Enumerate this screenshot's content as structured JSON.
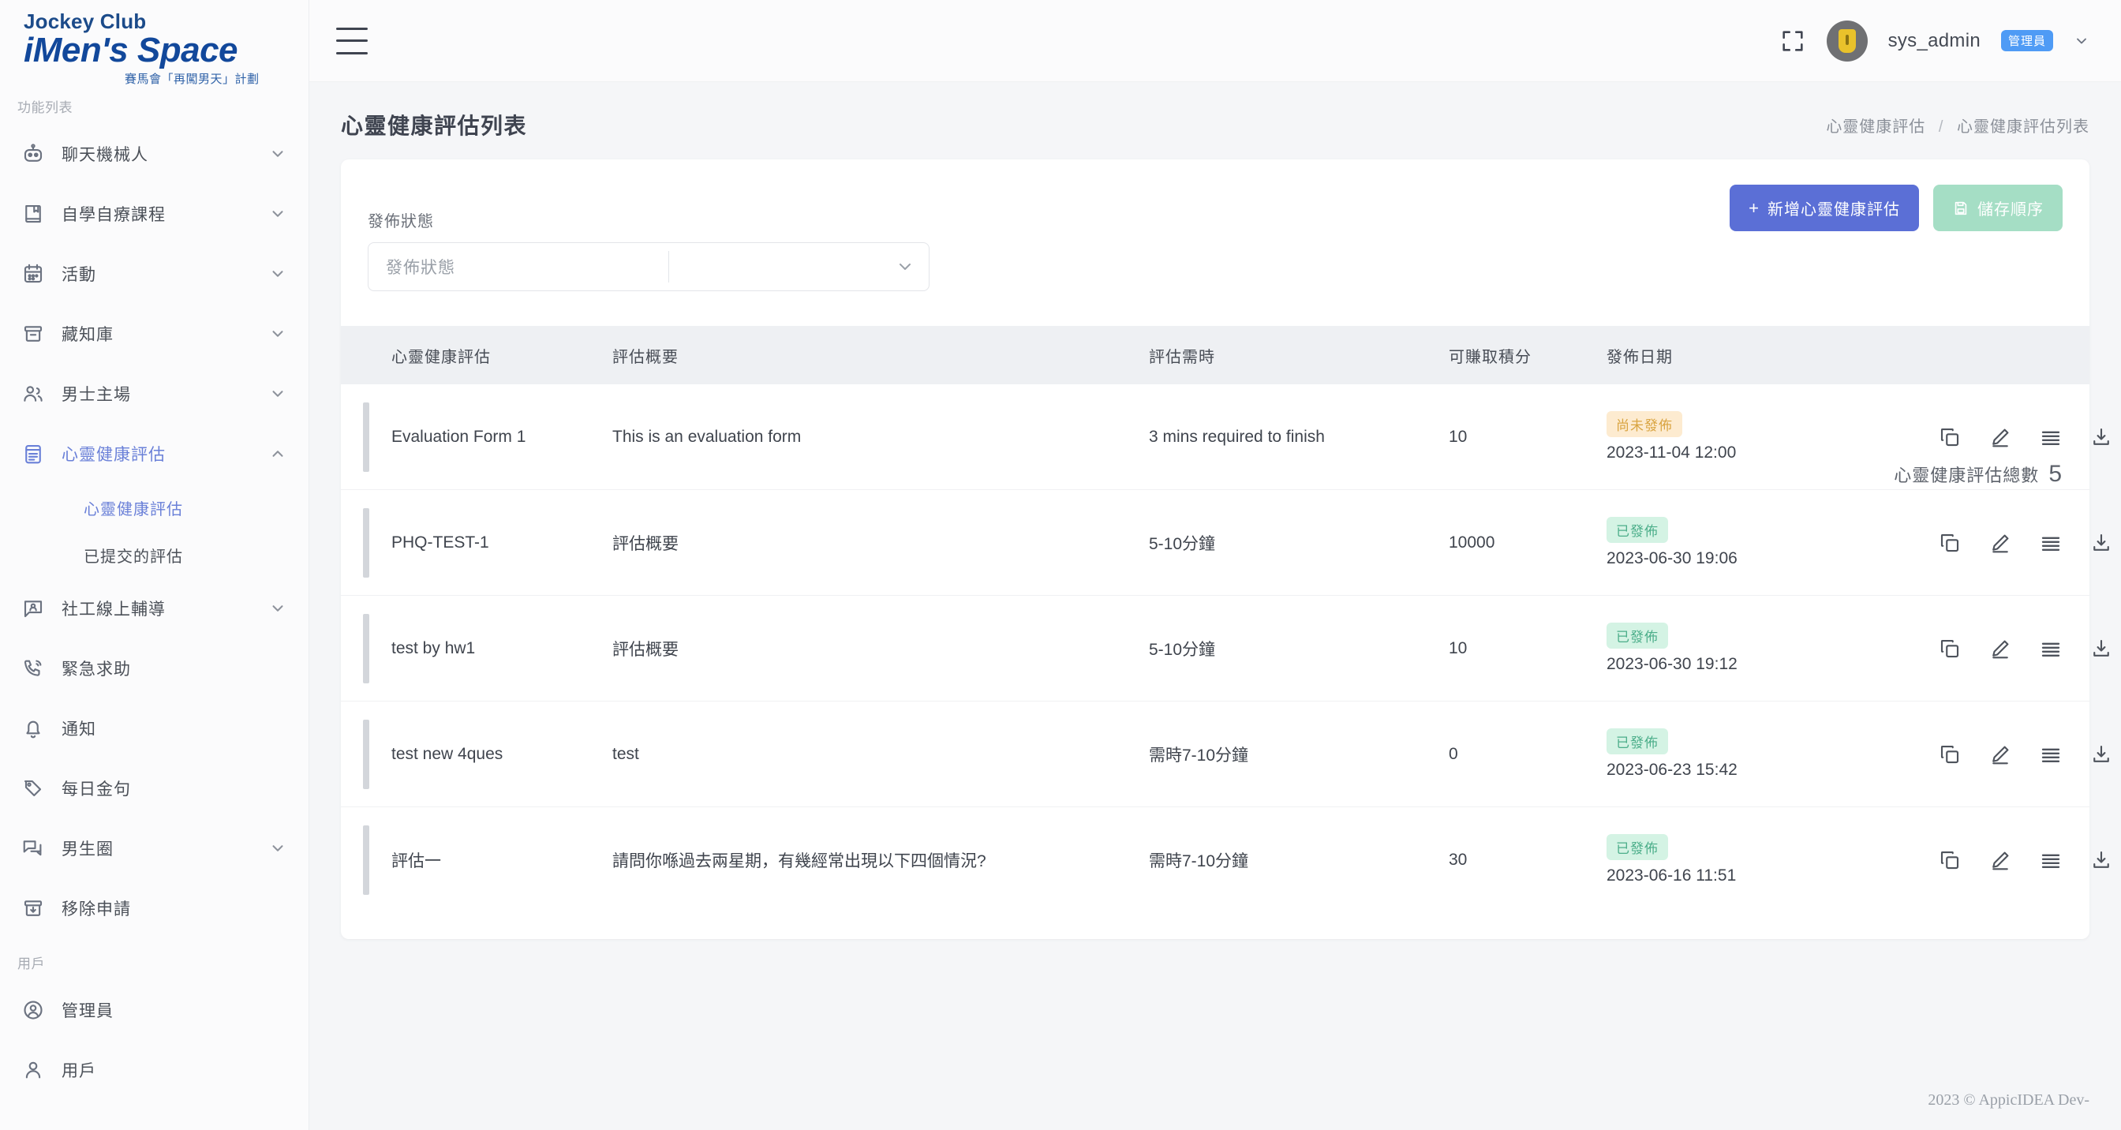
{
  "brand": {
    "line1": "Jockey Club",
    "line2": "iMen's Space",
    "line3": "賽馬會「再闖男天」計劃"
  },
  "topbar": {
    "menu_icon": "hamburger-icon",
    "fullscreen_icon": "fullscreen-icon",
    "username": "sys_admin",
    "role_badge": "管理員",
    "caret_icon": "chevron-down-icon"
  },
  "sidebar": {
    "section_label": "功能列表",
    "items": [
      {
        "label": "聊天機械人",
        "icon": "robot-icon",
        "expandable": true,
        "active": false
      },
      {
        "label": "自學自療課程",
        "icon": "book-icon",
        "expandable": true,
        "active": false
      },
      {
        "label": "活動",
        "icon": "calendar-icon",
        "expandable": true,
        "active": false
      },
      {
        "label": "藏知庫",
        "icon": "archive-icon",
        "expandable": true,
        "active": false
      },
      {
        "label": "男士主場",
        "icon": "users-icon",
        "expandable": true,
        "active": false
      },
      {
        "label": "心靈健康評估",
        "icon": "clipboard-icon",
        "expandable": true,
        "active": true
      },
      {
        "label": "社工線上輔導",
        "icon": "chat-user-icon",
        "expandable": true,
        "active": false
      },
      {
        "label": "緊急求助",
        "icon": "phone-call-icon",
        "expandable": false,
        "active": false
      },
      {
        "label": "通知",
        "icon": "bell-icon",
        "expandable": false,
        "active": false
      },
      {
        "label": "每日金句",
        "icon": "tag-icon",
        "expandable": false,
        "active": false
      },
      {
        "label": "男生圈",
        "icon": "comments-icon",
        "expandable": true,
        "active": false
      },
      {
        "label": "移除申請",
        "icon": "archive-down-icon",
        "expandable": false,
        "active": false
      }
    ],
    "sub_items": [
      {
        "label": "心靈健康評估",
        "active": true
      },
      {
        "label": "已提交的評估",
        "active": false
      }
    ],
    "user_section_label": "用戶",
    "user_items": [
      {
        "label": "管理員",
        "icon": "user-circle-icon"
      },
      {
        "label": "用戶",
        "icon": "user-icon"
      }
    ]
  },
  "page": {
    "title": "心靈健康評估列表",
    "breadcrumb": {
      "parent": "心靈健康評估",
      "separator": "/",
      "current": "心靈健康評估列表"
    }
  },
  "toolbar": {
    "add_label": "新增心靈健康評估",
    "add_plus": "+",
    "save_order_label": "儲存順序",
    "save_order_icon": "save-icon"
  },
  "filter": {
    "label": "發佈狀態",
    "placeholder": "發佈狀態",
    "value": "",
    "arrow_icon": "chevron-down-icon"
  },
  "total": {
    "label": "心靈健康評估總數",
    "count": "5"
  },
  "table": {
    "headers": [
      "心靈健康評估",
      "評估概要",
      "評估需時",
      "可賺取積分",
      "發佈日期"
    ],
    "action_icons": [
      "copy-icon",
      "edit-icon",
      "list-icon",
      "download-icon"
    ],
    "rows": [
      {
        "name": "Evaluation Form 1",
        "summary": "This is an evaluation form",
        "duration": "3 mins required to finish",
        "points": "10",
        "status": "尚未發佈",
        "status_type": "unpublished",
        "date": "2023-11-04 12:00"
      },
      {
        "name": "PHQ-TEST-1",
        "summary": "評估概要",
        "duration": "5-10分鐘",
        "points": "10000",
        "status": "已發佈",
        "status_type": "published",
        "date": "2023-06-30 19:06"
      },
      {
        "name": "test by hw1",
        "summary": "評估概要",
        "duration": "5-10分鐘",
        "points": "10",
        "status": "已發佈",
        "status_type": "published",
        "date": "2023-06-30 19:12"
      },
      {
        "name": "test new 4ques",
        "summary": "test",
        "duration": "需時7-10分鐘",
        "points": "0",
        "status": "已發佈",
        "status_type": "published",
        "date": "2023-06-23 15:42"
      },
      {
        "name": "評估一",
        "summary": "請問你喺過去兩星期，有幾經常出現以下四個情況?",
        "duration": "需時7-10分鐘",
        "points": "30",
        "status": "已發佈",
        "status_type": "published",
        "date": "2023-06-16 11:51"
      }
    ]
  },
  "footer": {
    "text": "2023 © AppicIDEA Dev-"
  },
  "colors": {
    "primary": "#5b6fd6",
    "accent_active": "#6a80d8",
    "published_badge": "#4cae8a",
    "unpublished_badge": "#d9a441",
    "role_badge": "#4f9bf5"
  }
}
